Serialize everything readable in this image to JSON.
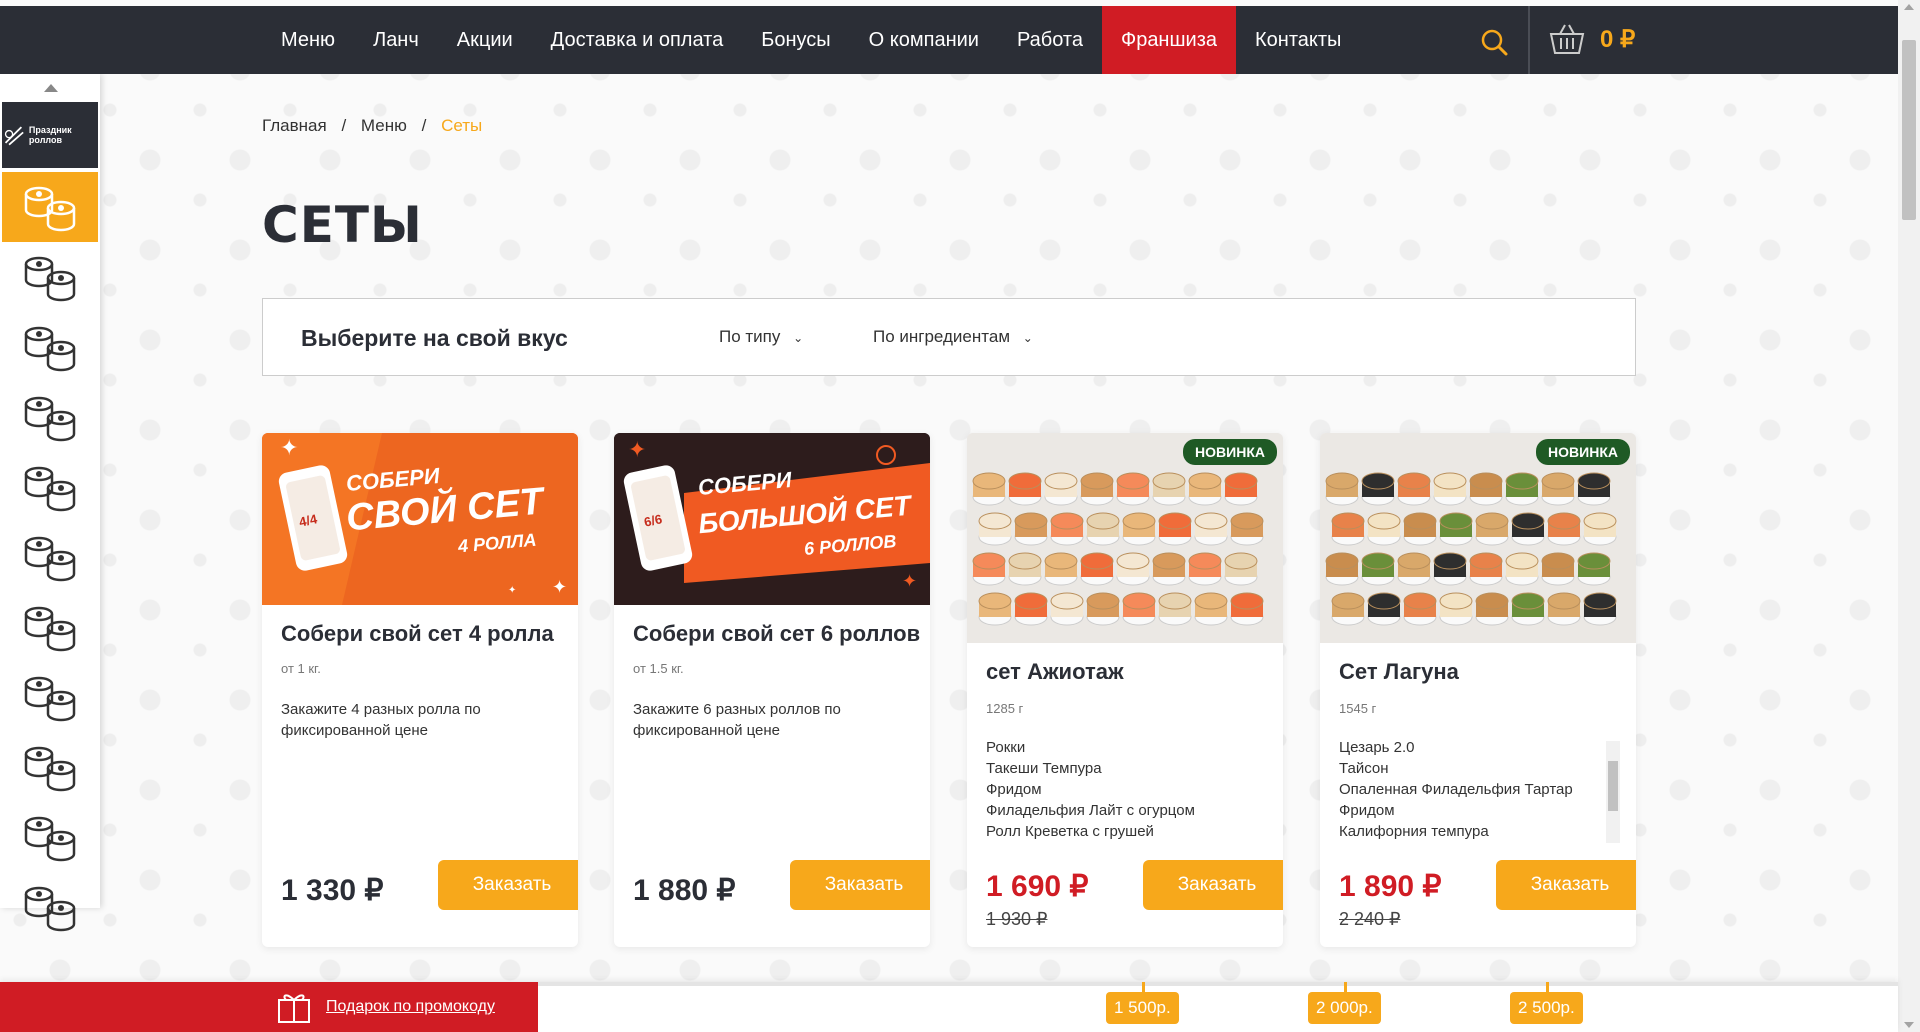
{
  "nav": {
    "items": [
      "Меню",
      "Ланч",
      "Акции",
      "Доставка и оплата",
      "Бонусы",
      "О компании",
      "Работа",
      "Франшиза",
      "Контакты"
    ],
    "active_index": 7,
    "cart_total": "0 ₽",
    "accent": "#f7a81b",
    "active_color": "#d01c24"
  },
  "sidebar": {
    "promo_label": "Праздник роллов",
    "items": [
      "sets-icon",
      "rolls-icon",
      "hot-rolls-icon",
      "gunkan-icon",
      "baked-icon",
      "mix-rolls-icon",
      "bowl-icon",
      "mini-rolls-icon",
      "tempura-icon",
      "sushi-icon",
      "salad-icon"
    ],
    "active_index": 0
  },
  "breadcrumb": {
    "home": "Главная",
    "menu": "Меню",
    "current": "Сеты",
    "sep": "/"
  },
  "page_title": "СЕТЫ",
  "filter": {
    "label": "Выберите на свой вкус",
    "by_type": "По типу",
    "by_ingredients": "По ингредиентам"
  },
  "cards": [
    {
      "name": "Собери свой сет 4 ролла",
      "weight": "от 1 кг.",
      "desc": "Закажите 4 разных ролла по фиксированной цене",
      "price": "1 330 ₽",
      "old_price": "",
      "badge": "",
      "order": "Заказать",
      "banner": {
        "top": "СОБЕРИ",
        "main": "СВОЙ СЕТ",
        "sub": "4 РОЛЛА",
        "phone": "4/4"
      }
    },
    {
      "name": "Собери свой сет 6 роллов",
      "weight": "от 1.5 кг.",
      "desc": "Закажите 6 разных роллов по фиксированной цене",
      "price": "1 880 ₽",
      "old_price": "",
      "badge": "",
      "order": "Заказать",
      "banner": {
        "top": "СОБЕРИ",
        "main": "БОЛЬШОЙ СЕТ",
        "sub": "6 РОЛЛОВ",
        "phone": "6/6"
      }
    },
    {
      "name": "сет Ажиотаж",
      "weight": "1285 г",
      "desc": "",
      "ingredients": [
        "Рокки",
        "Такеши Темпура",
        "Фридом",
        "Филадельфия Лайт с огурцом",
        "Ролл Креветка с грушей"
      ],
      "price": "1 690 ₽",
      "old_price": "1 930 ₽",
      "badge": "НОВИНКА",
      "order": "Заказать"
    },
    {
      "name": "Сет Лагуна",
      "weight": "1545 г",
      "desc": "",
      "ingredients": [
        "Цезарь 2.0",
        "Тайсон",
        "Опаленная Филадельфия Тартар",
        "Фридом",
        "Калифорния темпура"
      ],
      "price": "1 890 ₽",
      "old_price": "2 240 ₽",
      "badge": "НОВИНКА",
      "order": "Заказать"
    }
  ],
  "bottom": {
    "gift": "Подарок по промокоду",
    "steps": [
      "1 500р.",
      "2 000р.",
      "2 500р."
    ]
  }
}
